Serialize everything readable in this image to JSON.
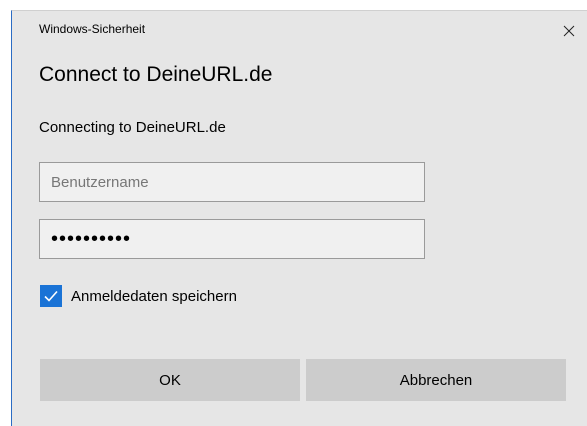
{
  "window": {
    "title": "Windows-Sicherheit",
    "close_icon": "close-icon"
  },
  "dialog": {
    "heading": "Connect to DeineURL.de",
    "message": "Connecting to DeineURL.de"
  },
  "form": {
    "username": {
      "value": "",
      "placeholder": "Benutzername"
    },
    "password": {
      "value": "••••••••••"
    },
    "remember": {
      "checked": true,
      "label": "Anmeldedaten speichern",
      "icon": "checkmark-icon"
    }
  },
  "buttons": {
    "ok_label": "OK",
    "cancel_label": "Abbrechen"
  },
  "colors": {
    "dialog_bg": "#e6e6e6",
    "accent": "#1a73d6",
    "button_bg": "#cccccc"
  }
}
